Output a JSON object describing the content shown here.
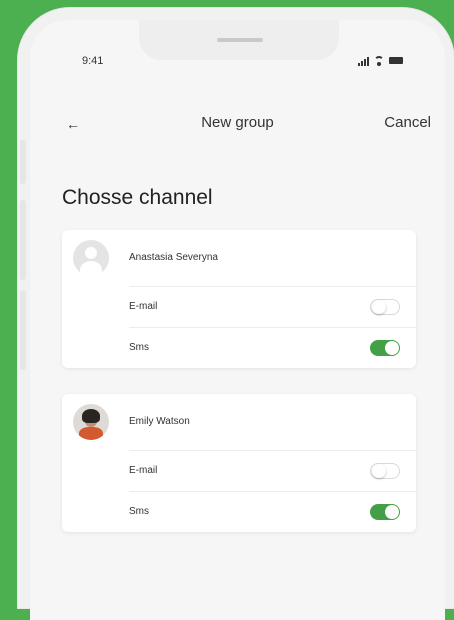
{
  "status": {
    "time": "9:41"
  },
  "nav": {
    "back_icon": "←",
    "title": "New group",
    "cancel": "Cancel"
  },
  "heading": "Chosse channel",
  "contacts": [
    {
      "name": "Anastasia Severyna",
      "avatar": "placeholder-user-icon",
      "options": [
        {
          "label": "E-mail",
          "enabled": false
        },
        {
          "label": "Sms",
          "enabled": true
        }
      ]
    },
    {
      "name": "Emily Watson",
      "avatar": "photo",
      "options": [
        {
          "label": "E-mail",
          "enabled": false
        },
        {
          "label": "Sms",
          "enabled": true
        }
      ]
    }
  ],
  "colors": {
    "background": "#4caf50",
    "toggle_on": "#43a047"
  }
}
